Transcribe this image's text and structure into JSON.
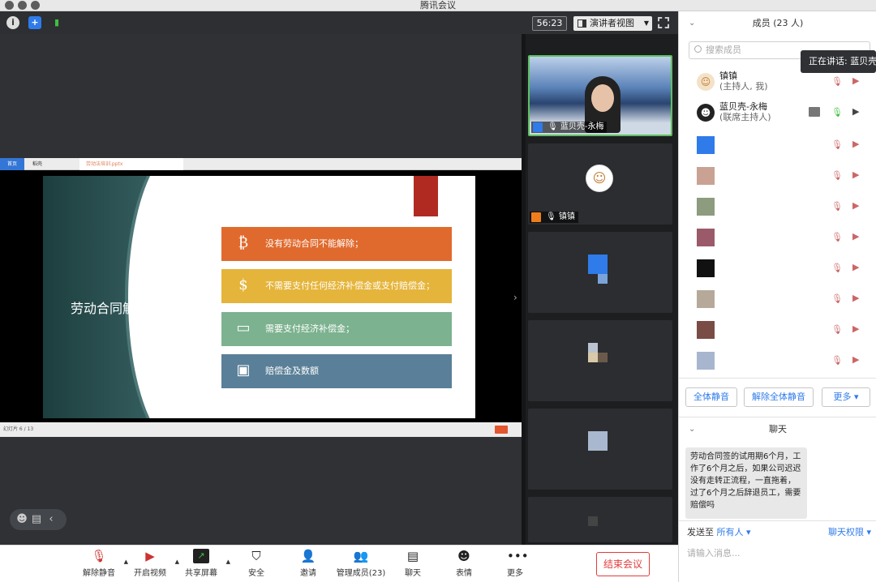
{
  "window": {
    "title": "腾讯会议"
  },
  "topbar": {
    "timer": "56:23",
    "view_mode": "演讲者视图"
  },
  "share": {
    "tabs": [
      "首页",
      "稻壳",
      "劳动法培训.pptx"
    ],
    "slide": {
      "title": "劳动合同解除",
      "items": [
        {
          "text": "没有劳动合同不能解除；",
          "color": "#e06a2e",
          "icon": "bitcoin-icon"
        },
        {
          "text": "不需要支付任何经济补偿金或支付赔偿金；",
          "color": "#e5b43a",
          "icon": "dollar-icon"
        },
        {
          "text": "需要支付经济补偿金；",
          "color": "#7cb28f",
          "icon": "banknote-icon"
        },
        {
          "text": "赔偿金及数额",
          "color": "#5a7f98",
          "icon": "tag-icon"
        }
      ]
    },
    "status": "幻灯片 6 / 13"
  },
  "tiles": [
    {
      "name": "蓝贝壳-永梅"
    },
    {
      "name": "镇镇"
    }
  ],
  "members_panel": {
    "header": "成员 (23 人)",
    "search_placeholder": "搜索成员",
    "tooltip": "正在讲话: 蓝贝壳",
    "members": [
      {
        "name": "镇镇",
        "role": "(主持人, 我)"
      },
      {
        "name": "蓝贝壳-永梅",
        "role": "(联席主持人)"
      }
    ],
    "buttons": {
      "mute_all": "全体静音",
      "unmute_all": "解除全体静音",
      "more": "更多 ▾"
    }
  },
  "chat": {
    "header": "聊天",
    "message": "劳动合同签的试用期6个月，工作了6个月之后，如果公司迟迟没有走转正流程，一直拖着，过了6个月之后辞退员工，需要赔偿吗",
    "send_to_label": "发送至",
    "send_to_value": "所有人 ▾",
    "permission": "聊天权限 ▾",
    "input_placeholder": "请输入消息..."
  },
  "toolbar": {
    "unmute": "解除静音",
    "start_video": "开启视频",
    "share_screen": "共享屏幕",
    "security": "安全",
    "invite": "邀请",
    "manage_members": "管理成员(23)",
    "chat": "聊天",
    "reactions": "表情",
    "more": "更多",
    "end_meeting": "结束会议"
  }
}
